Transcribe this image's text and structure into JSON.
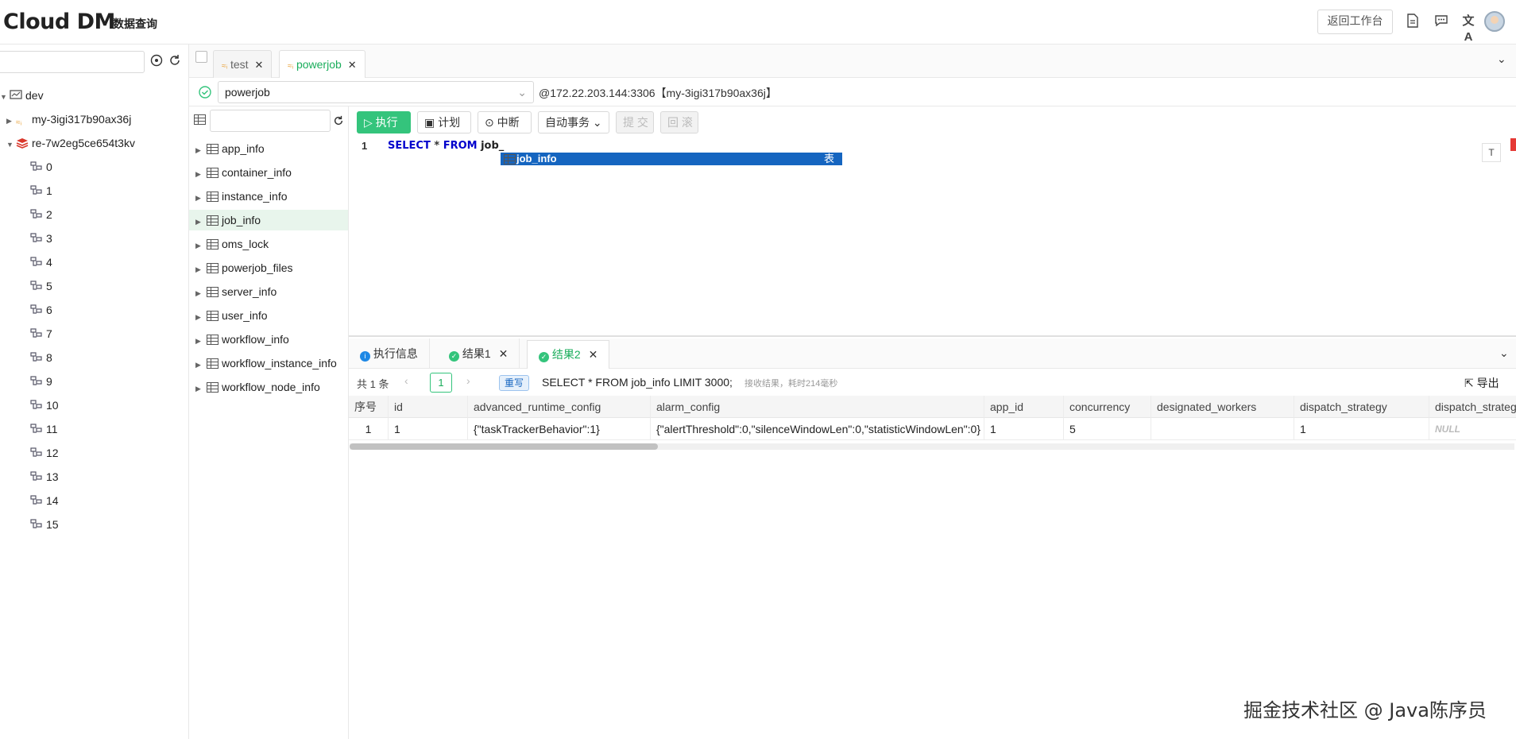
{
  "header": {
    "logo": "Cloud DM",
    "subtitle": "数据查询",
    "back_button": "返回工作台",
    "icons": [
      "document-icon",
      "chat-icon",
      "translate-icon",
      "avatar"
    ]
  },
  "left_tree": {
    "search_placeholder": "",
    "nodes": [
      {
        "label": "dev",
        "type": "environment",
        "expanded": true
      },
      {
        "label": "my-3igi317b90ax36j",
        "type": "mysql-instance",
        "expanded": false
      },
      {
        "label": "re-7w2eg5ce654t3kv",
        "type": "redis-instance",
        "expanded": true
      },
      {
        "label": "0"
      },
      {
        "label": "1"
      },
      {
        "label": "2"
      },
      {
        "label": "3"
      },
      {
        "label": "4"
      },
      {
        "label": "5"
      },
      {
        "label": "6"
      },
      {
        "label": "7"
      },
      {
        "label": "8"
      },
      {
        "label": "9"
      },
      {
        "label": "10"
      },
      {
        "label": "11"
      },
      {
        "label": "12"
      },
      {
        "label": "13"
      },
      {
        "label": "14"
      },
      {
        "label": "15"
      }
    ]
  },
  "tabs": [
    {
      "label": "test",
      "active": false
    },
    {
      "label": "powerjob",
      "active": true
    }
  ],
  "db_bar": {
    "database": "powerjob",
    "connection": "@172.22.203.144:3306【my-3igi317b90ax36j】"
  },
  "table_list": {
    "search_placeholder": "",
    "items": [
      "app_info",
      "container_info",
      "instance_info",
      "job_info",
      "oms_lock",
      "powerjob_files",
      "server_info",
      "user_info",
      "workflow_info",
      "workflow_instance_info",
      "workflow_node_info"
    ],
    "selected": "job_info"
  },
  "toolbar": {
    "run": "执行",
    "plan": "计划",
    "stop": "中断",
    "auto_tx": "自动事务",
    "commit": "提 交",
    "rollback": "回 滚"
  },
  "editor": {
    "line_number": "1",
    "kw_select": "SELECT",
    "star": " * ",
    "kw_from": "FROM",
    "rest": " job_",
    "autocomplete_item": "job_info",
    "autocomplete_type": "表",
    "t_button": "T"
  },
  "result_tabs": [
    {
      "label": "执行信息",
      "icon": "info-icon"
    },
    {
      "label": "结果1",
      "icon": "check-icon"
    },
    {
      "label": "结果2",
      "icon": "check-icon",
      "active": true
    }
  ],
  "result_info": {
    "total": "共 1 条",
    "page": "1",
    "rewrite": "重写",
    "sql": "SELECT * FROM job_info LIMIT 3000;",
    "timing": "接收结果，耗时214毫秒",
    "export": "导出"
  },
  "grid": {
    "columns": [
      "序号",
      "id",
      "advanced_runtime_config",
      "alarm_config",
      "app_id",
      "concurrency",
      "designated_workers",
      "dispatch_strategy",
      "dispatch_strateg"
    ],
    "rows": [
      [
        "1",
        "1",
        "{\"taskTrackerBehavior\":1}",
        "{\"alertThreshold\":0,\"silenceWindowLen\":0,\"statisticWindowLen\":0}",
        "1",
        "5",
        "",
        "1",
        "NULL"
      ]
    ]
  },
  "watermark": "掘金技术社区 @ Java陈序员"
}
